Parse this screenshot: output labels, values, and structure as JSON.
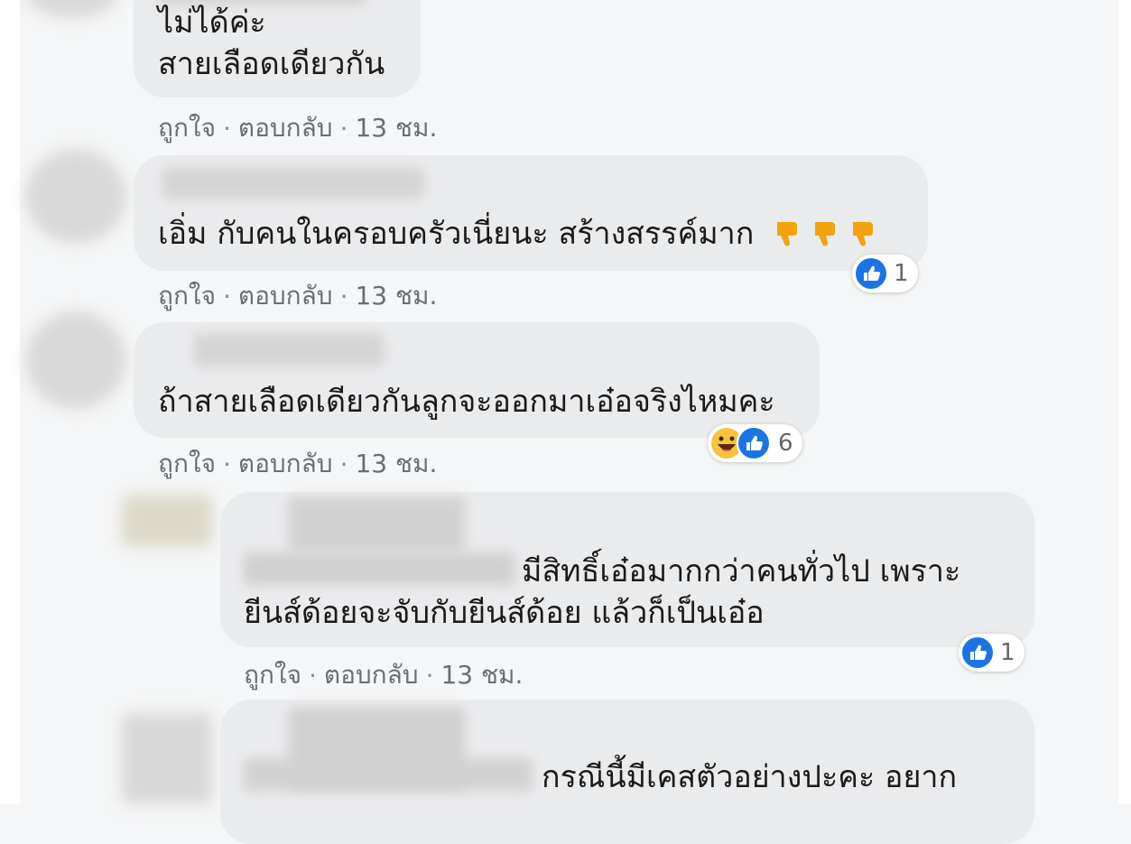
{
  "comments": [
    {
      "lines": [
        "ไม่ได้ค่ะ",
        "สายเลือดเดียวกัน"
      ],
      "actions": {
        "like": "ถูกใจ",
        "reply": "ตอบกลับ",
        "time": "13 ชม."
      }
    },
    {
      "lines": [
        "เอิ่ม กับคนในครอบครัวเนี่ยนะ สร้างสรรค์มาก"
      ],
      "emoji": [
        "thumbs-down-icon",
        "thumbs-down-icon",
        "thumbs-down-icon"
      ],
      "reaction": {
        "icons": [
          "like-icon"
        ],
        "count": "1"
      },
      "actions": {
        "like": "ถูกใจ",
        "reply": "ตอบกลับ",
        "time": "13 ชม."
      }
    },
    {
      "lines": [
        "ถ้าสายเลือดเดียวกันลูกจะออกมาเอ๋อจริงไหมคะ"
      ],
      "reaction": {
        "icons": [
          "haha-icon",
          "like-icon"
        ],
        "count": "6"
      },
      "actions": {
        "like": "ถูกใจ",
        "reply": "ตอบกลับ",
        "time": "13 ชม."
      }
    },
    {
      "lines": [
        "มีสิทธิ์เอ๋อมากกว่าคนทั่วไป เพราะ",
        "ยีนส์ด้อยจะจับกับยีนส์ด้อย แล้วก็เป็นเอ๋อ"
      ],
      "reaction": {
        "icons": [
          "like-icon"
        ],
        "count": "1"
      },
      "actions": {
        "like": "ถูกใจ",
        "reply": "ตอบกลับ",
        "time": "13 ชม."
      }
    },
    {
      "lines": [
        "กรณีนี้มีเคสตัวอย่างปะคะ อยาก"
      ]
    }
  ],
  "separator": "·",
  "colors": {
    "bubble": "#eaebed",
    "like": "#1b74e4",
    "haha": "#f6c33a",
    "dislike": "#f2a20c"
  }
}
